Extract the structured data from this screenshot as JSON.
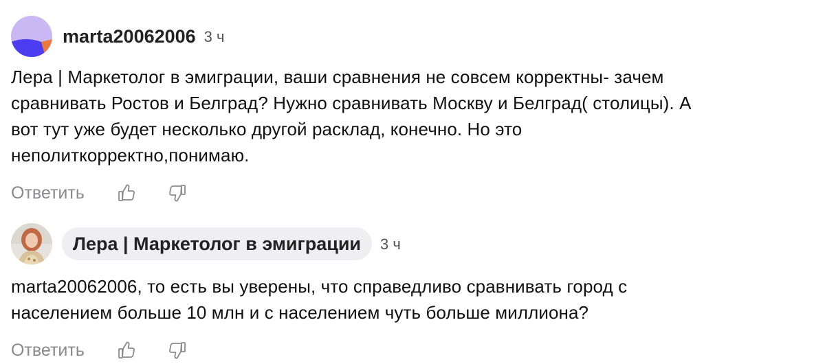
{
  "comments": [
    {
      "author": "marta20062006",
      "time": "3 ч",
      "text_lines": [
        "Лера | Маркетолог в эмиграции, ваши сравнения не совсем корректны- зачем",
        "сравнивать Ростов и Белград? Нужно сравнивать Москву и Белград( столицы). А",
        "вот тут уже будет несколько другой расклад, конечно. Но это",
        "неполиткорректно,понимаю."
      ],
      "reply_label": "Ответить",
      "like_icon": "thumbs-up-icon",
      "dislike_icon": "thumbs-down-icon"
    },
    {
      "author": "Лера | Маркетолог в эмиграции",
      "time": "3 ч",
      "text_lines": [
        "marta20062006, то есть вы уверены, что справедливо сравнивать город с",
        "населением больше 10 млн и с населением чуть больше миллиона?"
      ],
      "reply_label": "Ответить",
      "like_icon": "thumbs-up-icon",
      "dislike_icon": "thumbs-down-icon"
    }
  ],
  "colors": {
    "avatar_lavender": "#c9b8f3",
    "avatar_blue": "#4c3ef0",
    "avatar_orange": "#ee7a3a",
    "chip_bg": "#efeff1",
    "muted": "#8a8a8e"
  }
}
